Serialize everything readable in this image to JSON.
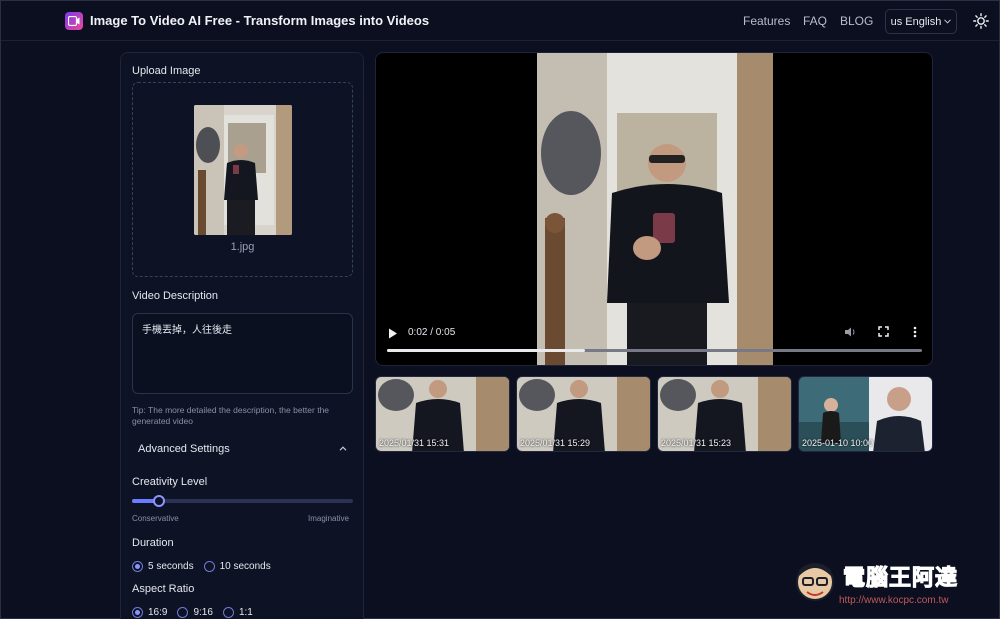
{
  "header": {
    "title": "Image To Video AI Free - Transform Images into Videos",
    "nav": [
      "Features",
      "FAQ",
      "BLOG"
    ],
    "language": "us English"
  },
  "upload": {
    "label": "Upload Image",
    "file_name": "1.jpg"
  },
  "description": {
    "label": "Video Description",
    "value": "手機丟掉，人往後走",
    "tip": "Tip: The more detailed the description, the better the generated video"
  },
  "advanced": {
    "label": "Advanced Settings",
    "creativity": {
      "label": "Creativity Level",
      "min_label": "Conservative",
      "max_label": "Imaginative",
      "value_fraction": 0.12
    },
    "duration": {
      "label": "Duration",
      "options": [
        "5 seconds",
        "10 seconds"
      ],
      "selected": "5 seconds"
    },
    "aspect_ratio": {
      "label": "Aspect Ratio",
      "options": [
        "16:9",
        "9:16",
        "1:1"
      ],
      "selected": "16:9"
    }
  },
  "player": {
    "time": "0:02 / 0:05",
    "progress_fraction": 0.37
  },
  "history": [
    {
      "date": "2025/01/31 15:31"
    },
    {
      "date": "2025/01/31 15:29"
    },
    {
      "date": "2025/01/31 15:23"
    },
    {
      "date": "2025-01-10 10:00"
    }
  ],
  "watermark": {
    "text": "電腦王阿達",
    "url": "http://www.kocpc.com.tw"
  },
  "colors": {
    "background": "#0b0f1f",
    "accent": "#6b7cff",
    "logo_gradient_start": "#7c3aed",
    "logo_gradient_end": "#ec4899"
  }
}
